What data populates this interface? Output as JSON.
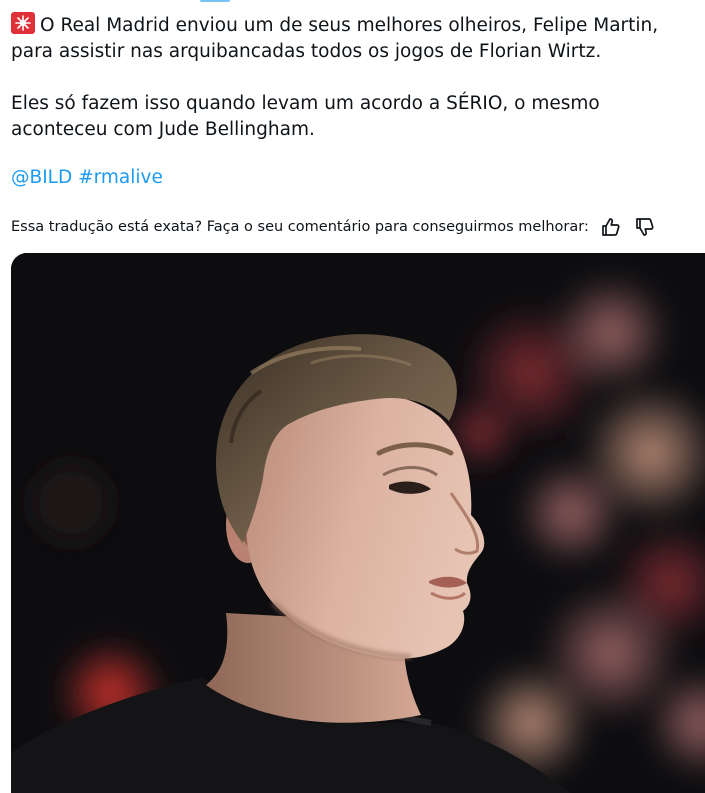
{
  "tweet": {
    "alert_emoji": "siren-emoji",
    "line1": "O Real Madrid enviou um de seus melhores olheiros, Felipe Martin,",
    "line2": "para assistir nas arquibancadas todos os jogos de Florian Wirtz.",
    "line3": "Eles só fazem isso quando levam um acordo a SÉRIO, o mesmo",
    "line4": "aconteceu com Jude Bellingham.",
    "mention": "@BILD",
    "hashtag": "#rmalive"
  },
  "translation_feedback": {
    "prompt": "Essa tradução está exata? Faça o seu comentário para conseguirmos melhorar:",
    "thumbs_up_icon": "thumbs-up-icon",
    "thumbs_down_icon": "thumbs-down-icon"
  },
  "media": {
    "type": "photo"
  },
  "colors": {
    "text": "#0f1419",
    "link": "#1d9bf0",
    "alert": "#e0313a"
  }
}
